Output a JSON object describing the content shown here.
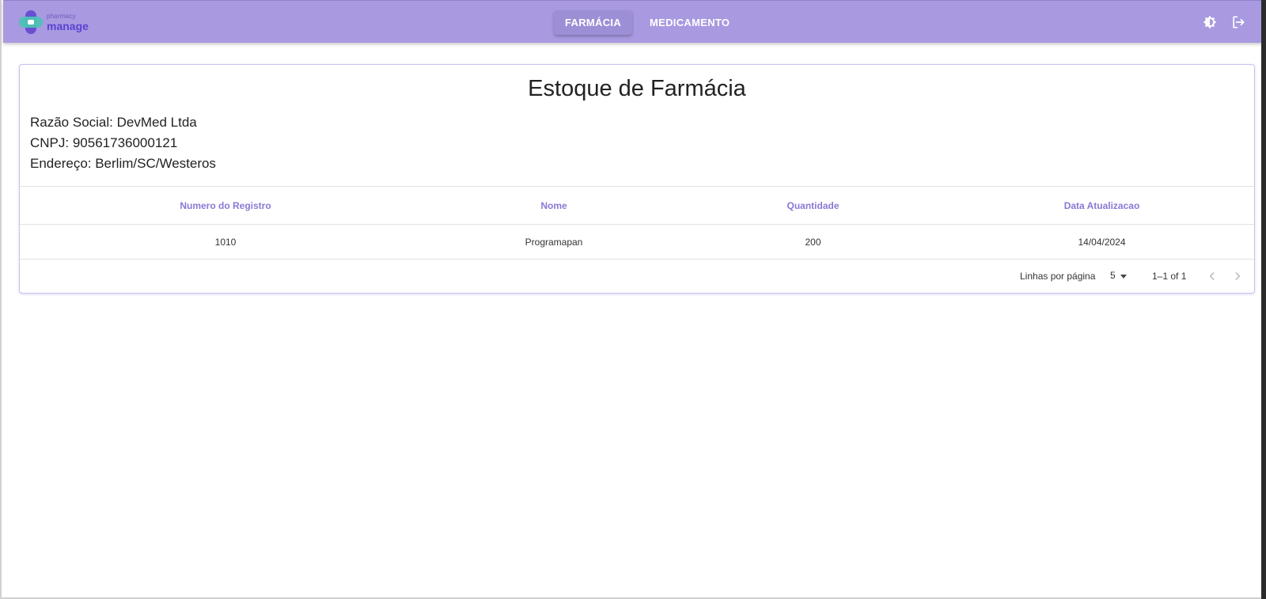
{
  "app": {
    "logo_small": "pharmacy",
    "logo_big": "manage"
  },
  "nav": {
    "tabs": [
      {
        "label": "FARMÁCIA",
        "active": true
      },
      {
        "label": "MEDICAMENTO",
        "active": false
      }
    ]
  },
  "actions": {
    "theme_icon": "brightness-icon",
    "logout_icon": "logout-icon"
  },
  "page": {
    "title": "Estoque de Farmácia",
    "razao_social": "Razão Social: DevMed Ltda",
    "cnpj": "CNPJ: 90561736000121",
    "endereco": "Endereço: Berlim/SC/Westeros"
  },
  "table": {
    "columns": [
      "Numero do Registro",
      "Nome",
      "Quantidade",
      "Data Atualizacao"
    ],
    "rows": [
      [
        "1010",
        "Programapan",
        "200",
        "14/04/2024"
      ]
    ]
  },
  "pagination": {
    "rows_per_page_label": "Linhas por página",
    "rows_per_page_value": "5",
    "range": "1–1 of 1"
  },
  "colors": {
    "appbar": "#a899e1",
    "accent": "#8b78d6",
    "brand_purple": "#6a4fd1",
    "brand_teal": "#4dc2b5"
  }
}
